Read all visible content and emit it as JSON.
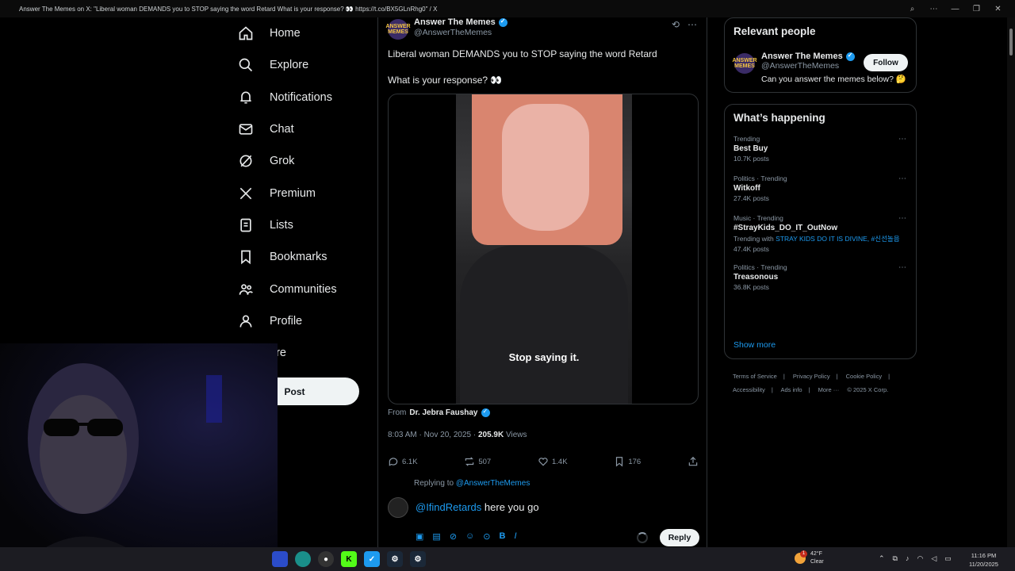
{
  "window": {
    "title": "Answer The Memes on X: \"Liberal woman DEMANDS you to STOP saying the word Retard What is your response? 👀 https://t.co/BX5GLnRhg0\" / X"
  },
  "nav": {
    "items": [
      {
        "label": "Home",
        "icon": "home-icon"
      },
      {
        "label": "Explore",
        "icon": "search-icon"
      },
      {
        "label": "Notifications",
        "icon": "bell-icon"
      },
      {
        "label": "Chat",
        "icon": "mail-icon"
      },
      {
        "label": "Grok",
        "icon": "grok-icon"
      },
      {
        "label": "Premium",
        "icon": "x-logo-icon"
      },
      {
        "label": "Lists",
        "icon": "list-icon"
      },
      {
        "label": "Bookmarks",
        "icon": "bookmark-icon"
      },
      {
        "label": "Communities",
        "icon": "people-icon"
      },
      {
        "label": "Profile",
        "icon": "person-icon"
      }
    ],
    "more_label": "ore",
    "post_label": "Post"
  },
  "tweet": {
    "author_name": "Answer The Memes",
    "author_handle": "@AnswerTheMemes",
    "avatar_text": "ANSWER MEMES",
    "text_line1": "Liberal woman DEMANDS you to STOP saying the word Retard",
    "text_line2": "What is your response? 👀",
    "video_subtitle": "Stop saying it.",
    "from_label": "From",
    "from_name": "Dr. Jebra Faushay",
    "time": "8:03 AM · Nov 20, 2025 · ",
    "views_count": "205.9K",
    "views_label": " Views",
    "actions": {
      "replies": "6.1K",
      "reposts": "507",
      "likes": "1.4K",
      "bookmarks": "176"
    }
  },
  "reply": {
    "replying_prefix": "Replying to ",
    "replying_handle": "@AnswerTheMemes",
    "mention": "@IfindRetards",
    "text": " here you go",
    "button_label": "Reply"
  },
  "relevant": {
    "title": "Relevant people",
    "name": "Answer The Memes",
    "handle": "@AnswerTheMemes",
    "bio": "Can you answer the memes below? 🤔",
    "follow_label": "Follow"
  },
  "happening": {
    "title": "What’s happening",
    "trends": [
      {
        "context": "Trending",
        "name": "Best Buy",
        "with_prefix": "",
        "with_links": "",
        "count": "10.7K posts"
      },
      {
        "context": "Politics · Trending",
        "name": "Witkoff",
        "with_prefix": "",
        "with_links": "",
        "count": "27.4K posts"
      },
      {
        "context": "Music · Trending",
        "name": "#StrayKids_DO_IT_OutNow",
        "with_prefix": "Trending with ",
        "with_links": "STRAY KIDS DO IT IS DIVINE, #신선놀음",
        "count": "47.4K posts"
      },
      {
        "context": "Politics · Trending",
        "name": "Treasonous",
        "with_prefix": "",
        "with_links": "",
        "count": "36.8K posts"
      }
    ],
    "show_more": "Show more"
  },
  "footer": {
    "line1": [
      "Terms of Service",
      "|",
      "Privacy Policy",
      "|",
      "Cookie Policy",
      "|"
    ],
    "line2": [
      "Accessibility",
      "|",
      "Ads info",
      "|",
      "More ···",
      "© 2025 X Corp."
    ]
  },
  "taskbar": {
    "temp": "42°F",
    "condition": "Clear",
    "badge": "1",
    "time": "11:16 PM",
    "date": "11/20/2025"
  }
}
